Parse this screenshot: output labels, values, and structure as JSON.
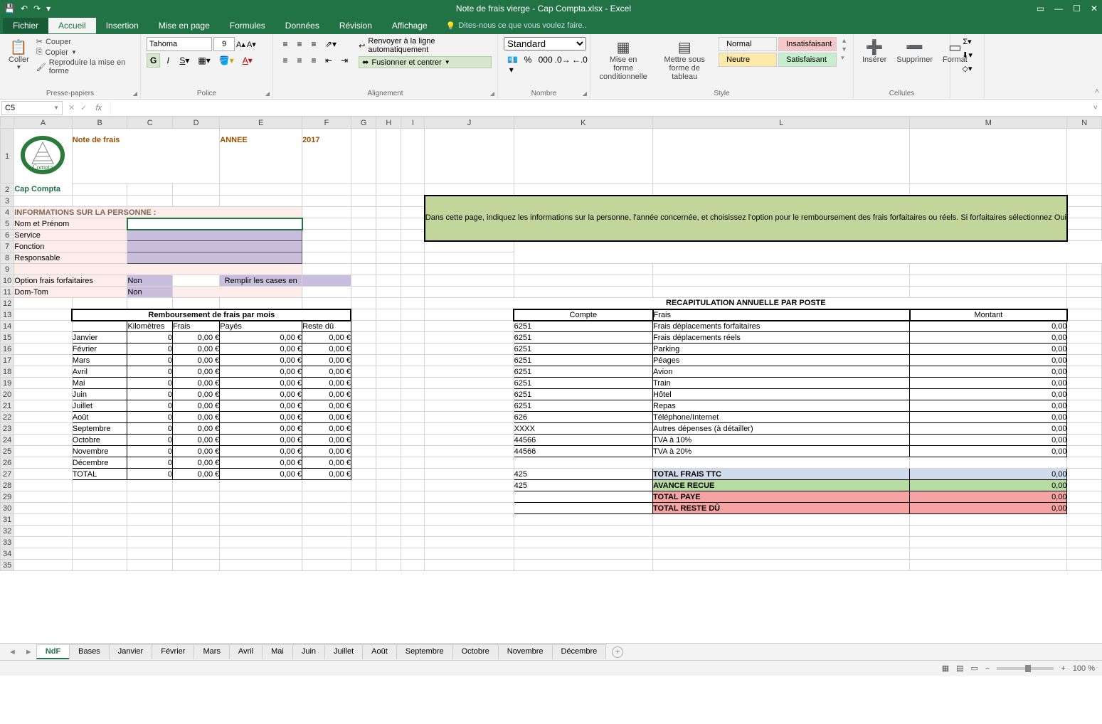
{
  "app": {
    "title": "Note de frais vierge - Cap Compta.xlsx - Excel"
  },
  "qat": {
    "save": "💾",
    "undo": "↶",
    "redo": "↷"
  },
  "tabs": [
    "Fichier",
    "Accueil",
    "Insertion",
    "Mise en page",
    "Formules",
    "Données",
    "Révision",
    "Affichage"
  ],
  "tellme": "Dites-nous ce que vous voulez faire..",
  "ribbon": {
    "clipboard": {
      "paste": "Coller",
      "cut": "Couper",
      "copy": "Copier",
      "brush": "Reproduire la mise en forme",
      "label": "Presse-papiers"
    },
    "font": {
      "name": "Tahoma",
      "size": "9",
      "label": "Police"
    },
    "align": {
      "wrap": "Renvoyer à la ligne automatiquement",
      "merge": "Fusionner et centrer",
      "label": "Alignement"
    },
    "number": {
      "format": "Standard",
      "label": "Nombre"
    },
    "styles": {
      "cond": "Mise en forme conditionnelle",
      "table": "Mettre sous forme de tableau",
      "normal": "Normal",
      "bad": "Insatisfaisant",
      "neutral": "Neutre",
      "good": "Satisfaisant",
      "label": "Style"
    },
    "cells": {
      "insert": "Insérer",
      "delete": "Supprimer",
      "format": "Format",
      "label": "Cellules"
    }
  },
  "namebox": "C5",
  "sheet": {
    "title": "Note de frais",
    "year_label": "ANNEE",
    "year": "2017",
    "brand": "Cap Compta",
    "info_header": "INFORMATIONS SUR LA PERSONNE :",
    "info_labels": [
      "Nom et Prénom",
      "Service",
      "Fonction",
      "Responsable"
    ],
    "opt_forfait": "Option frais forfaitaires",
    "domtom": "Dom-Tom",
    "non": "Non",
    "remplir": "Remplir les cases en",
    "tip": "Dans cette page, indiquez les informations sur la personne, l'année concernée, et choisissez l'option pour le remboursement des frais forfaitaires ou réels. Si forfaitaires sélectionnez Oui",
    "remb_title": "Remboursement de frais par mois",
    "remb_headers": [
      "Kilomètres",
      "Frais",
      "Payés",
      "Reste dû"
    ],
    "months": [
      "Janvier",
      "Février",
      "Mars",
      "Avril",
      "Mai",
      "Juin",
      "Juillet",
      "Août",
      "Septembre",
      "Octobre",
      "Novembre",
      "Décembre"
    ],
    "total": "TOTAL",
    "zero_km": "0",
    "zero_eur": "0,00 €",
    "zero": "0,00",
    "recap_title": "RECAPITULATION ANNUELLE PAR POSTE",
    "recap_headers": [
      "Compte",
      "Frais",
      "Montant"
    ],
    "recap_rows": [
      {
        "c": "6251",
        "f": "Frais déplacements forfaitaires",
        "m": "0,00"
      },
      {
        "c": "6251",
        "f": "Frais déplacements réels",
        "m": "0,00"
      },
      {
        "c": "6251",
        "f": "Parking",
        "m": "0,00"
      },
      {
        "c": "6251",
        "f": "Péages",
        "m": "0,00"
      },
      {
        "c": "6251",
        "f": "Avion",
        "m": "0,00"
      },
      {
        "c": "6251",
        "f": "Train",
        "m": "0,00"
      },
      {
        "c": "6251",
        "f": "Hôtel",
        "m": "0,00"
      },
      {
        "c": "6251",
        "f": "Repas",
        "m": "0,00"
      },
      {
        "c": "626",
        "f": "Téléphone/Internet",
        "m": "0,00"
      },
      {
        "c": "XXXX",
        "f": "Autres dépenses (à détailler)",
        "m": "0,00"
      },
      {
        "c": "44566",
        "f": "TVA à 10%",
        "m": "0,00"
      },
      {
        "c": "44566",
        "f": "TVA à 20%",
        "m": "0,00"
      }
    ],
    "recap_totals": [
      {
        "c": "425",
        "f": "TOTAL FRAIS TTC",
        "m": "0,00",
        "cls": "row-total-ttc"
      },
      {
        "c": "425",
        "f": "AVANCE RECUE",
        "m": "0,00",
        "cls": "row-avance"
      },
      {
        "c": "",
        "f": "TOTAL PAYE",
        "m": "0,00",
        "cls": "row-paye"
      },
      {
        "c": "",
        "f": "TOTAL RESTE DÛ",
        "m": "0,00",
        "cls": "row-reste"
      }
    ]
  },
  "sheets": [
    "NdF",
    "Bases",
    "Janvier",
    "Février",
    "Mars",
    "Avril",
    "Mai",
    "Juin",
    "Juillet",
    "Août",
    "Septembre",
    "Octobre",
    "Novembre",
    "Décembre"
  ],
  "status": {
    "zoom": "100 %"
  }
}
